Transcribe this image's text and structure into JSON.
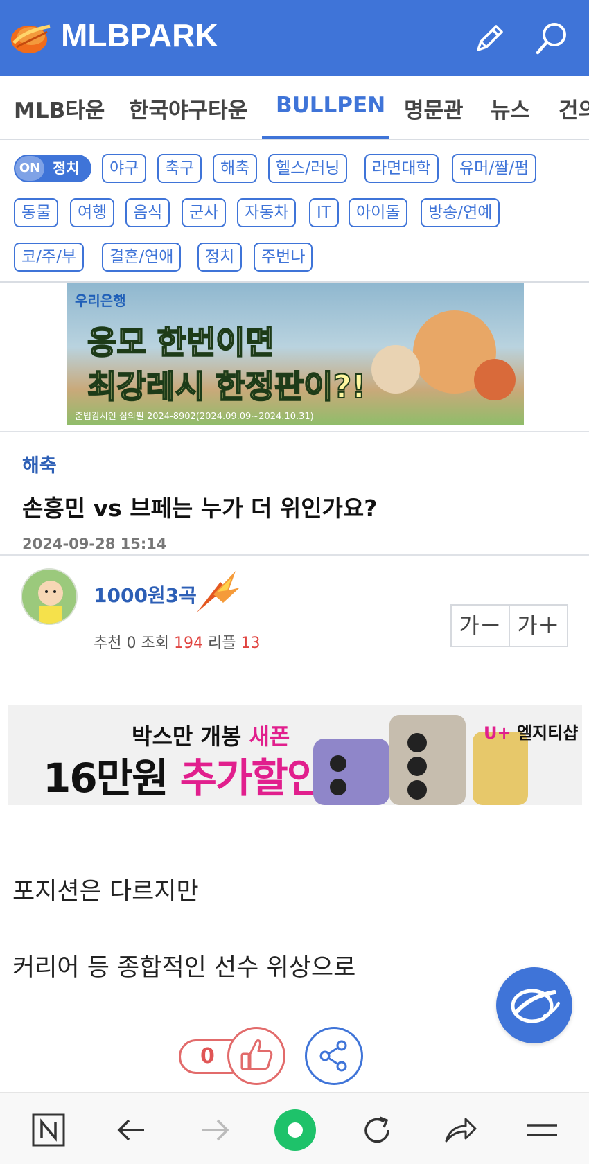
{
  "header": {
    "logo_text": "MLBPARK",
    "icons": [
      "pencil-icon",
      "search-icon"
    ],
    "brand_color": "#3f74d8"
  },
  "nav": {
    "tabs": [
      {
        "label": "MLB타운",
        "active": false
      },
      {
        "label": "한국야구타운",
        "active": false
      },
      {
        "label": "BULLPEN",
        "active": true
      },
      {
        "label": "명문관",
        "active": false
      },
      {
        "label": "뉴스",
        "active": false
      },
      {
        "label": "건의",
        "active": false
      }
    ]
  },
  "categories": {
    "toggle_state": "ON",
    "toggle_label": "정치",
    "chips": [
      "야구",
      "축구",
      "해축",
      "헬스/러닝",
      "라면대학",
      "유머/짤/펌",
      "동물",
      "여행",
      "음식",
      "군사",
      "자동차",
      "IT",
      "아이돌",
      "방송/연예",
      "코/주/부",
      "결혼/연애",
      "정치",
      "주번나"
    ]
  },
  "ad_top": {
    "brand": "우리은행",
    "line1": "응모 한번이면",
    "line2": "최강레시 한정판이?!",
    "fine_print": "준법감시인 심의필 2024-8902(2024.09.09~2024.10.31)"
  },
  "article": {
    "category": "해축",
    "title": "손흥민 vs 브페는 누가 더 위인가요?",
    "date": "2024-09-28 15:14",
    "author": "1000원3곡",
    "stats": {
      "recommend_label": "추천",
      "recommend": "0",
      "views_label": "조회",
      "views": "194",
      "replies_label": "리플",
      "replies": "13"
    },
    "font_smaller": "가－",
    "font_larger": "가＋",
    "body": [
      "포지션은 다르지만",
      "커리어 등 종합적인 선수 위상으로"
    ]
  },
  "ad_mid": {
    "top_line_a": "박스만 개봉 ",
    "top_line_b": "새폰",
    "main_a": "16만원 ",
    "main_b": "추가할인",
    "brand_u": "U",
    "brand_plus": "+",
    "brand_rest": " 엘지티샵"
  },
  "actions": {
    "like_count": "0"
  },
  "bottom_bar": {
    "icons": [
      "naver-n-icon",
      "back-arrow-icon",
      "forward-arrow-icon",
      "home-circle-icon",
      "refresh-icon",
      "share-arrow-icon",
      "menu-icon"
    ]
  }
}
